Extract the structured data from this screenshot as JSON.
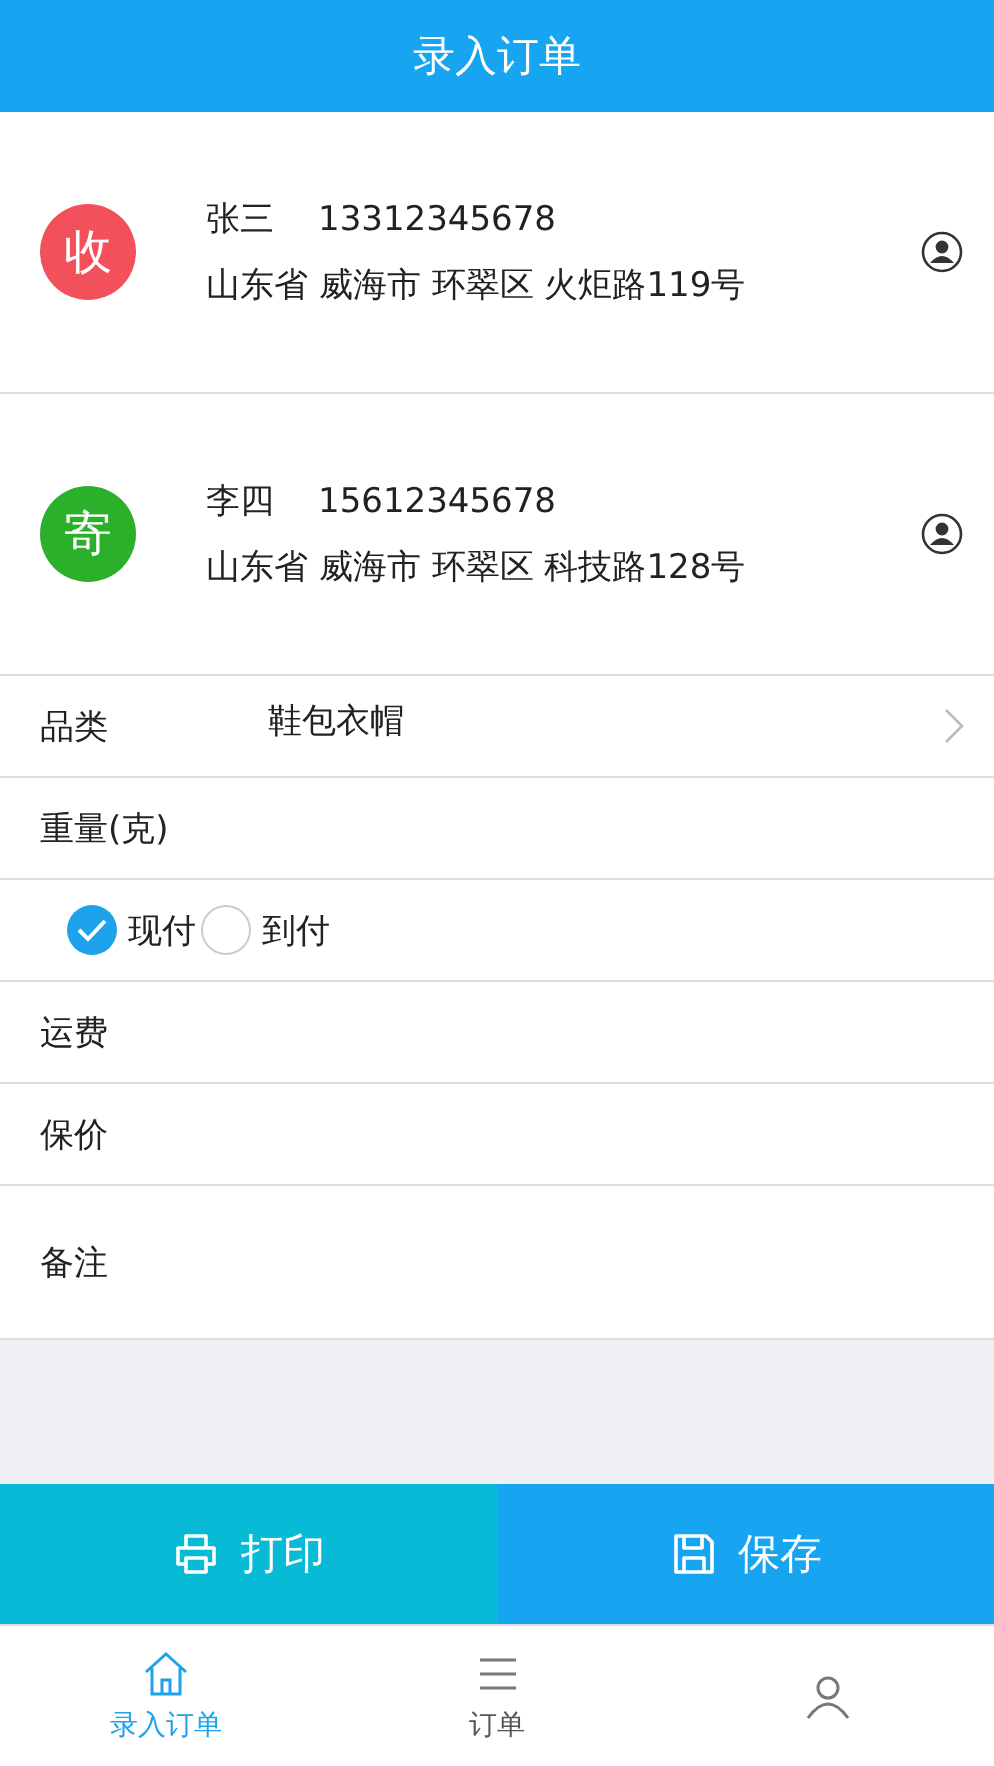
{
  "header": {
    "title": "录入订单"
  },
  "contacts": [
    {
      "badge": "收",
      "color": "#f2515b",
      "name": "张三",
      "phone": "13312345678",
      "address": "山东省 威海市 环翠区 火炬路119号"
    },
    {
      "badge": "寄",
      "color": "#2bb02b",
      "name": "李四",
      "phone": "15612345678",
      "address": "山东省 威海市 环翠区 科技路128号"
    }
  ],
  "fields": [
    {
      "kind": "select",
      "label": "品类",
      "value": "鞋包衣帽"
    },
    {
      "kind": "input",
      "label": "重量(克)"
    },
    {
      "kind": "radio",
      "options": [
        {
          "label": "现付",
          "selected": true
        },
        {
          "label": "到付",
          "selected": false
        }
      ]
    },
    {
      "kind": "input",
      "label": "运费"
    },
    {
      "kind": "input",
      "label": "保价"
    },
    {
      "kind": "note",
      "label": "备注"
    }
  ],
  "actions": [
    {
      "kind": "print",
      "label": "打印"
    },
    {
      "kind": "save",
      "label": "保存"
    }
  ],
  "tabs": [
    {
      "kind": "home",
      "label": "录入订单",
      "selected": true
    },
    {
      "kind": "list",
      "label": "订单",
      "selected": false
    },
    {
      "kind": "user",
      "selected": false
    }
  ]
}
